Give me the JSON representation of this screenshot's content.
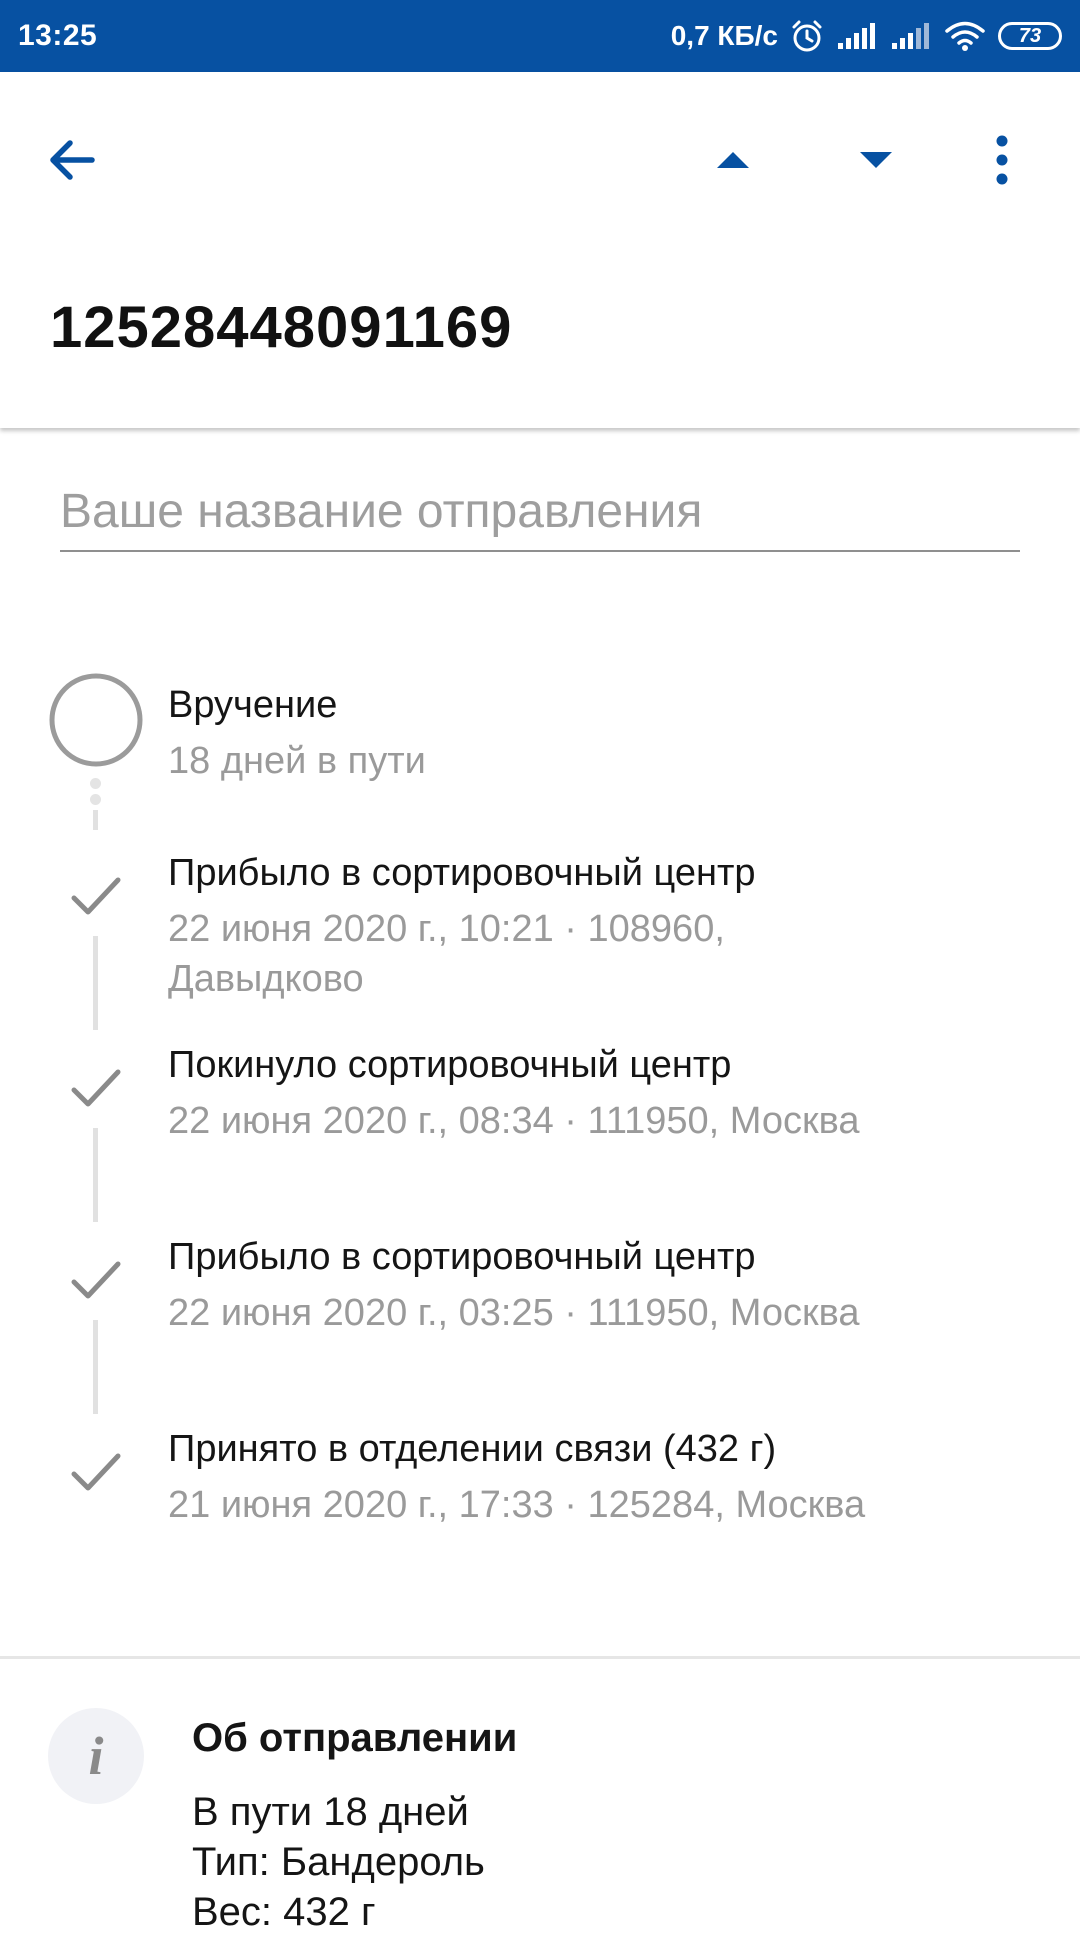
{
  "status_bar": {
    "time": "13:25",
    "speed": "0,7 КБ/с",
    "battery": "73",
    "icons": [
      "alarm-icon",
      "signal-icon",
      "signal-icon",
      "wifi-icon",
      "battery-icon"
    ],
    "color": "#0751a2"
  },
  "toolbar": {
    "tracking_number": "12528448091169",
    "icons": [
      "back-arrow-icon",
      "triangle-up-icon",
      "triangle-down-icon",
      "more-vert-icon"
    ],
    "accent": "#0751a2"
  },
  "name_field": {
    "placeholder": "Ваше название отправления",
    "value": ""
  },
  "timeline": {
    "events": [
      {
        "title": "Вручение",
        "subtitle": "18 дней в пути",
        "status": "pending"
      },
      {
        "title": "Прибыло в сортировочный центр",
        "subtitle": "22 июня 2020 г., 10:21 · 108960, Давыдково",
        "status": "done"
      },
      {
        "title": "Покинуло сортировочный центр",
        "subtitle": "22 июня 2020 г., 08:34 · 111950, Москва",
        "status": "done"
      },
      {
        "title": "Прибыло в сортировочный центр",
        "subtitle": "22 июня 2020 г., 03:25 · 111950, Москва",
        "status": "done"
      },
      {
        "title": "Принято в отделении связи (432 г)",
        "subtitle": "21 июня 2020 г., 17:33 · 125284, Москва",
        "status": "done"
      }
    ]
  },
  "info": {
    "icon": "info-icon",
    "icon_glyph": "i",
    "title": "Об отправлении",
    "lines": [
      "В пути 18 дней",
      "Тип: Бандероль",
      "Вес: 432 г"
    ]
  }
}
